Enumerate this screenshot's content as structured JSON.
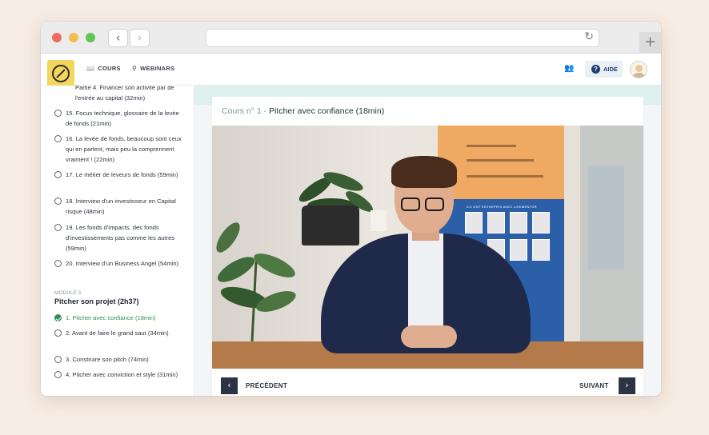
{
  "browser": {
    "back_icon": "chevron-left-icon",
    "forward_icon": "chevron-right-icon",
    "reload_icon": "reload-icon",
    "new_tab_icon": "plus-icon"
  },
  "header": {
    "nav": [
      {
        "label": "COURS",
        "icon": "book-icon"
      },
      {
        "label": "WEBINARS",
        "icon": "presenter-icon"
      }
    ],
    "help_label": "AIDE",
    "colors": {
      "logo": "#f2d65e",
      "help_bg": "#e9f1f7",
      "accent": "#1f3d6e"
    }
  },
  "sidebar": {
    "lessons_before": [
      {
        "text": "Partie 4. Financer son activité par de l'entrée au capital (32min)"
      },
      {
        "text": "15. Focus technique, glossaire de la levée de fonds (21min)"
      },
      {
        "text": "16. La levée de fonds, beaucoup sont ceux qui en parlent, mais peu la comprennent vraiment ! (22min)"
      },
      {
        "text": "17. Le métier de leveurs de fonds (59min)"
      },
      {
        "text": "18. Interview d'un investisseur en Capital risque (48min)"
      },
      {
        "text": "19. Les fonds d'impacts, des fonds d'investissements pas comme les autres (59min)"
      },
      {
        "text": "20. Interview d'un Business Angel (54min)"
      }
    ],
    "module_label": "MODULE 5",
    "module_title": "Pitcher son projet (2h37)",
    "lessons_after": [
      {
        "text": "1. Pitcher avec confiance (18min)",
        "status": "completed"
      },
      {
        "text": "2. Avant de faire le grand saut (34min)"
      },
      {
        "text": "3. Construire son pitch (74min)"
      },
      {
        "text": "4. Pitcher avec conviction et style (31min)"
      }
    ],
    "active_color": "#2f8f5a"
  },
  "course": {
    "prefix": "Cours n° 1 -",
    "title": "Pitcher avec confiance (18min)"
  },
  "video": {
    "banner_lines": [
      "Des cours concrets",
      "Des mentors entrepreneurs",
      "Une communauté d'entraide"
    ],
    "banner_caption": "ILS ONT ENTREPRIS AVEC LIVEMENTOR"
  },
  "controls": {
    "prev_label": "PRÉCÉDENT",
    "next_label": "SUIVANT"
  }
}
